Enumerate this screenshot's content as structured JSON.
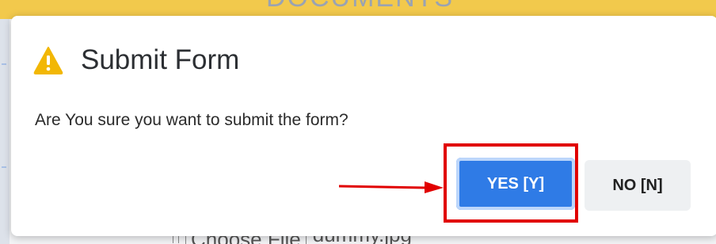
{
  "background": {
    "header_text": "DOCUMENTS",
    "file_button_label": "Choose File",
    "file_name": "dummy.jpg"
  },
  "dialog": {
    "icon": "warning-icon",
    "title": "Submit Form",
    "message": "Are You sure you want to submit the form?",
    "yes_label": "YES [Y]",
    "no_label": "NO [N]"
  },
  "colors": {
    "header_bar": "#f2c94c",
    "yes_button": "#2f7be6",
    "no_button": "#eef0f2",
    "warning": "#f2b705",
    "annotation": "#e10000"
  }
}
